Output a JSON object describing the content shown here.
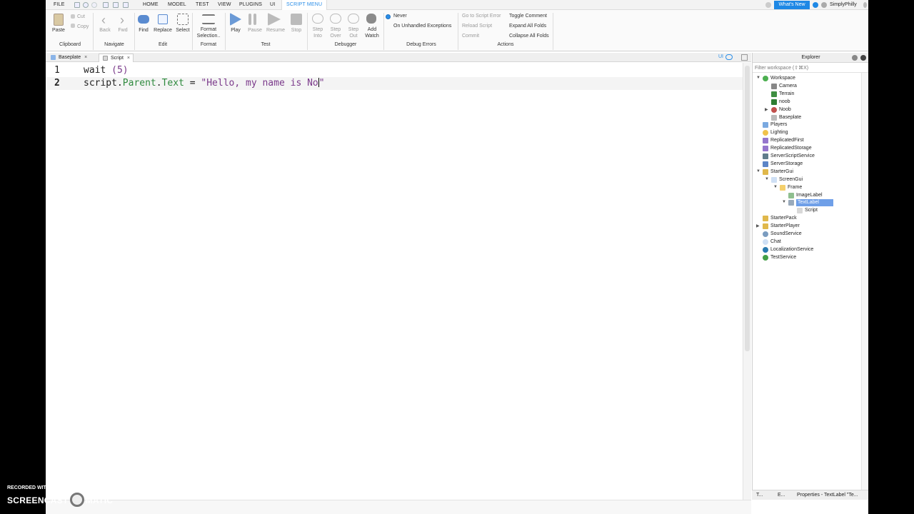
{
  "menubar": {
    "tabs": [
      "FILE",
      "HOME",
      "MODEL",
      "TEST",
      "VIEW",
      "PLUGINS",
      "UI",
      "SCRIPT MENU"
    ],
    "whats_new": "What's New",
    "user": "SimplyPhilly"
  },
  "ribbon": {
    "clipboard": {
      "paste": "Paste",
      "cut": "Cut",
      "copy": "Copy",
      "group": "Clipboard"
    },
    "navigate": {
      "back": "Back",
      "fwd": "Fwd",
      "group": "Navigate"
    },
    "edit": {
      "find": "Find",
      "replace": "Replace",
      "select": "Select",
      "group": "Edit"
    },
    "format": {
      "format1": "Format",
      "format2": "Selection..",
      "group": "Format"
    },
    "test": {
      "play": "Play",
      "pause": "Pause",
      "resume": "Resume",
      "stop": "Stop",
      "group": "Test"
    },
    "debugger": {
      "step_into1": "Step",
      "step_into2": "Into",
      "step_over1": "Step",
      "step_over2": "Over",
      "step_out1": "Step",
      "step_out2": "Out",
      "add_watch1": "Add",
      "add_watch2": "Watch",
      "group": "Debugger"
    },
    "debug_errors": {
      "never": "Never",
      "unhandled": "On Unhandled Exceptions",
      "group": "Debug Errors"
    },
    "actions": {
      "go_to_error": "Go to Script Error",
      "reload": "Reload Script",
      "commit": "Commit",
      "toggle_comment": "Toggle Comment",
      "expand": "Expand All Folds",
      "collapse": "Collapse All Folds",
      "group": "Actions"
    }
  },
  "tabs": {
    "baseplate": "Baseplate",
    "script": "Script",
    "close": "×",
    "ui_toggle": "UI"
  },
  "editor": {
    "line_numbers": [
      "1",
      "2"
    ],
    "line1": {
      "kw": "wait",
      "rest": " (5)"
    },
    "line2": {
      "obj": "script",
      "dot1": ".",
      "parent": "Parent",
      "dot2": ".",
      "text": "Text",
      "eq": " = ",
      "str": "\"Hello, my name is No",
      "quote": "\""
    }
  },
  "explorer": {
    "title": "Explorer",
    "filter_placeholder": "Filter workspace (⇧⌘X)",
    "nodes": [
      {
        "label": "Workspace"
      },
      {
        "label": "Camera"
      },
      {
        "label": "Terrain"
      },
      {
        "label": "noob"
      },
      {
        "label": "Noob"
      },
      {
        "label": "Baseplate"
      },
      {
        "label": "Players"
      },
      {
        "label": "Lighting"
      },
      {
        "label": "ReplicatedFirst"
      },
      {
        "label": "ReplicatedStorage"
      },
      {
        "label": "ServerScriptService"
      },
      {
        "label": "ServerStorage"
      },
      {
        "label": "StarterGui"
      },
      {
        "label": "ScreenGui"
      },
      {
        "label": "Frame"
      },
      {
        "label": "ImageLabel"
      },
      {
        "label": "TextLabel"
      },
      {
        "label": "Script"
      },
      {
        "label": "StarterPack"
      },
      {
        "label": "StarterPlayer"
      },
      {
        "label": "SoundService"
      },
      {
        "label": "Chat"
      },
      {
        "label": "LocalizationService"
      },
      {
        "label": "TestService"
      }
    ],
    "bottom_tabs": [
      "T...",
      "E...",
      "Properties - TextLabel \"Te..."
    ]
  },
  "watermark": {
    "line1": "RECORDED WITH",
    "screen": "SCREENCAST",
    "matic": "MATIC"
  },
  "colors": {
    "accent": "#2a8ee8",
    "selection": "#6f9fe8",
    "member": "#2f8a3e",
    "string": "#7b3a8b"
  }
}
